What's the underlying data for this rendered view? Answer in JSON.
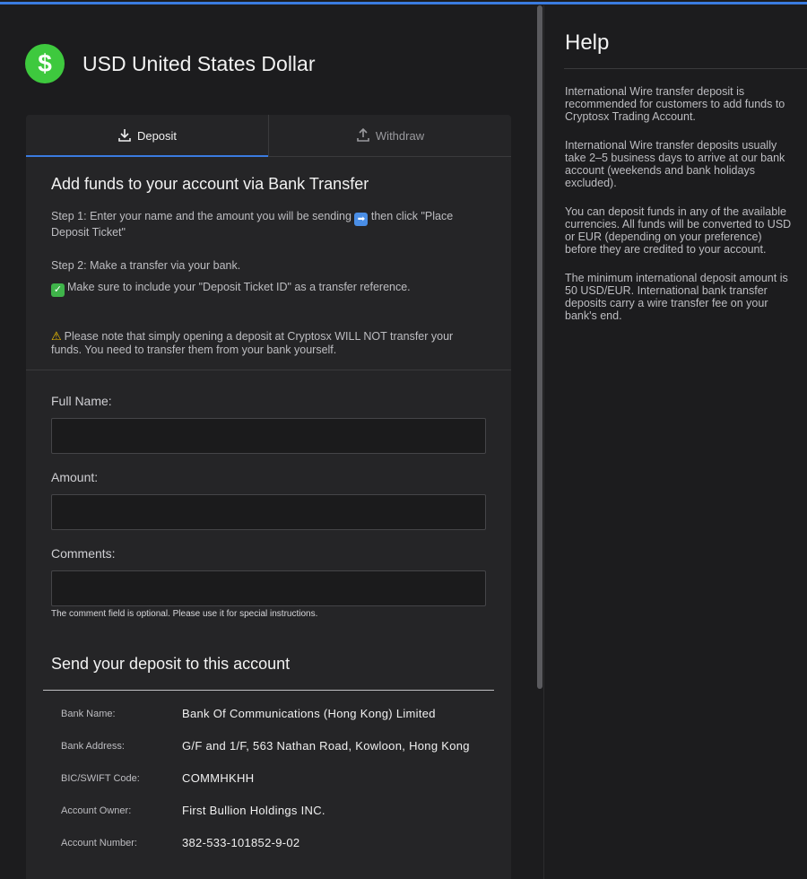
{
  "currency": {
    "icon": "dollar-sign-icon",
    "symbol": "$",
    "title": "USD United States Dollar"
  },
  "tabs": [
    {
      "label": "Deposit",
      "icon": "download-icon",
      "active": true
    },
    {
      "label": "Withdraw",
      "icon": "upload-icon",
      "active": false
    }
  ],
  "intro": {
    "title": "Add funds to your account via Bank Transfer",
    "step1_before": "Step 1:  Enter your name and the amount you will be sending ",
    "step1_emoji": "➡",
    "step1_after": " then click \"Place Deposit Ticket\"",
    "step2": "Step 2:  Make a transfer via your bank.",
    "step2_emoji": "✓",
    "step2_note": "Make sure to include your \"Deposit Ticket ID\" as a transfer reference.",
    "warning_emoji": "⚠",
    "warning": "Please note that simply opening a deposit at Cryptosx WILL NOT transfer your funds. You need to transfer them from your bank yourself."
  },
  "form": {
    "full_name_label": "Full Name:",
    "full_name_value": "",
    "amount_label": "Amount:",
    "amount_value": "",
    "comments_label": "Comments:",
    "comments_value": "",
    "comments_hint": "The comment field is optional. Please use it for special instructions."
  },
  "deposit_account": {
    "title": "Send your deposit to this account",
    "rows": [
      {
        "key": "Bank Name:",
        "value": "Bank Of Communications (Hong Kong) Limited"
      },
      {
        "key": "Bank Address:",
        "value": "G/F and 1/F, 563 Nathan Road, Kowloon, Hong Kong"
      },
      {
        "key": "BIC/SWIFT Code:",
        "value": "COMMHKHH"
      },
      {
        "key": "Account Owner:",
        "value": "First Bullion Holdings INC."
      },
      {
        "key": "Account Number:",
        "value": "382-533-101852-9-02"
      }
    ]
  },
  "help": {
    "title": "Help",
    "paragraphs": [
      "International Wire transfer deposit is recommended for customers to add funds to Cryptosx Trading Account.",
      "International Wire transfer deposits usually take 2–5 business days to arrive at our bank account (weekends and bank holidays excluded).",
      "You can deposit funds in any of the available currencies. All funds will be converted to USD or EUR (depending on your preference) before they are credited to your account.",
      "The minimum international deposit amount is 50 USD/EUR. International bank transfer deposits carry a wire transfer fee on your bank's end."
    ]
  },
  "colors": {
    "accent": "#3a7be0",
    "dollar_icon": "#3ec93e",
    "background": "#1c1c1e",
    "card": "#252527"
  }
}
